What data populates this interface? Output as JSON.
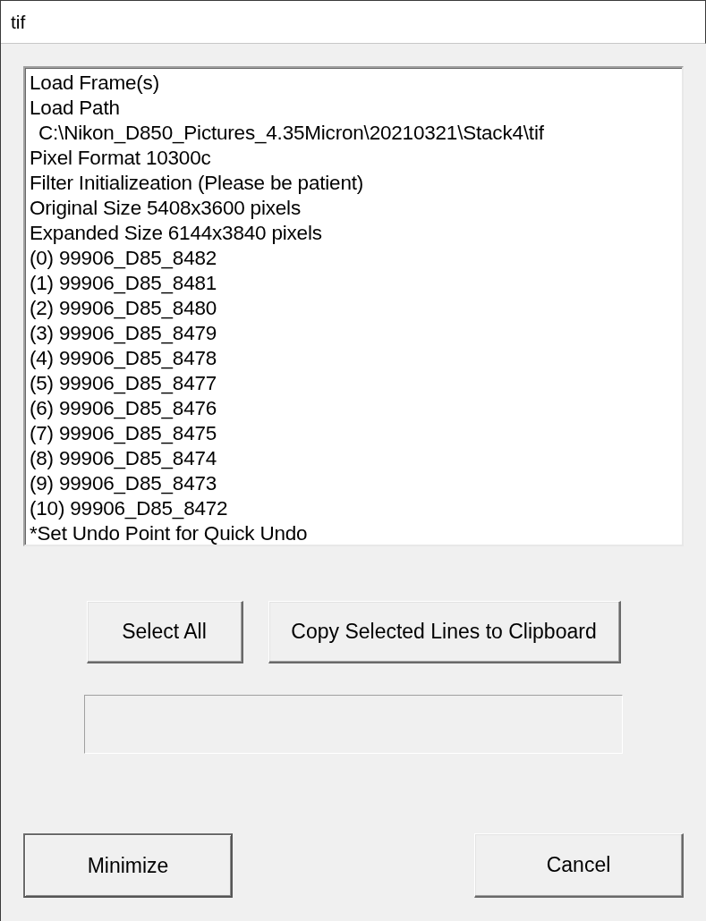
{
  "window": {
    "title": "tif"
  },
  "log": {
    "lines": [
      {
        "text": "Load Frame(s)"
      },
      {
        "text": "Load Path",
        "children": [
          {
            "text": "C:\\Nikon_D850_Pictures_4.35Micron\\20210321\\Stack4\\tif"
          }
        ]
      },
      {
        "text": "Pixel Format 10300c"
      },
      {
        "text": "Filter Initializeation (Please be patient)"
      },
      {
        "text": "Original Size 5408x3600 pixels"
      },
      {
        "text": "Expanded Size 6144x3840 pixels"
      },
      {
        "text": "(0) 99906_D85_8482"
      },
      {
        "text": "(1) 99906_D85_8481"
      },
      {
        "text": "(2) 99906_D85_8480"
      },
      {
        "text": "(3) 99906_D85_8479"
      },
      {
        "text": "(4) 99906_D85_8478"
      },
      {
        "text": "(5) 99906_D85_8477"
      },
      {
        "text": "(6) 99906_D85_8476"
      },
      {
        "text": "(7) 99906_D85_8475"
      },
      {
        "text": "(8) 99906_D85_8474"
      },
      {
        "text": "(9) 99906_D85_8473"
      },
      {
        "text": "(10) 99906_D85_8472"
      },
      {
        "text": "*Set Undo Point for Quick Undo"
      }
    ]
  },
  "action_buttons": [
    {
      "label": "Select All"
    },
    {
      "label": "Copy Selected Lines to Clipboard"
    }
  ],
  "footer_buttons": [
    {
      "label": "Minimize",
      "default": true
    },
    {
      "label": "Cancel",
      "default": false
    }
  ]
}
